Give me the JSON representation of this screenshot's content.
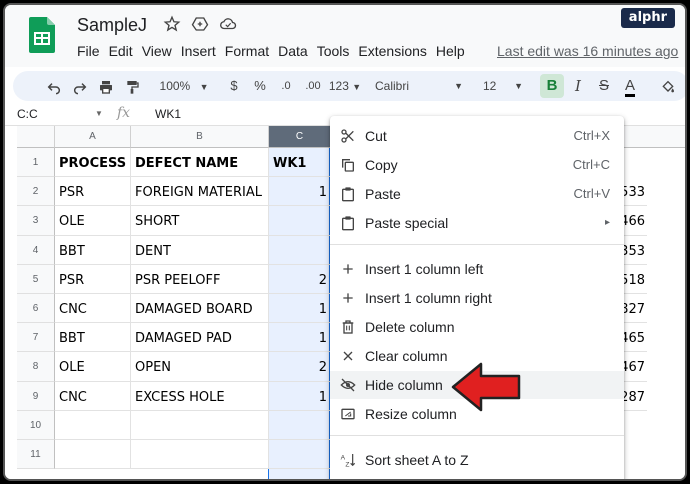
{
  "watermark": "alphr",
  "doc": {
    "title": "SampleJ",
    "last_edit": "Last edit was 16 minutes ago",
    "menu": [
      "File",
      "Edit",
      "View",
      "Insert",
      "Format",
      "Data",
      "Tools",
      "Extensions",
      "Help"
    ]
  },
  "toolbar": {
    "zoom": "100%",
    "currency": "$",
    "percent": "%",
    "dec_decrease": ".0",
    "dec_increase": ".00",
    "more_formats": "123",
    "font": "Calibri",
    "font_size": "12",
    "bold": "B",
    "italic": "I",
    "strike": "S",
    "text_color": "A"
  },
  "formula_bar": {
    "name_box": "C:C",
    "fx": "fx",
    "value": "WK1"
  },
  "columns": [
    "A",
    "B",
    "C"
  ],
  "rows": [
    "1",
    "2",
    "3",
    "4",
    "5",
    "6",
    "7",
    "8",
    "9",
    "10",
    "11"
  ],
  "table": {
    "header": [
      "PROCESS",
      "DEFECT NAME",
      "WK1"
    ],
    "data": [
      [
        "PSR",
        "FOREIGN MATERIAL",
        "1",
        "533"
      ],
      [
        "OLE",
        "SHORT",
        "",
        "466"
      ],
      [
        "BBT",
        "DENT",
        "",
        "353"
      ],
      [
        "PSR",
        "PSR PEELOFF",
        "2",
        "518"
      ],
      [
        "CNC",
        "DAMAGED BOARD",
        "1",
        "827"
      ],
      [
        "BBT",
        "DAMAGED PAD",
        "1",
        "465"
      ],
      [
        "OLE",
        "OPEN",
        "2",
        "467"
      ],
      [
        "CNC",
        "EXCESS HOLE",
        "1",
        "287"
      ]
    ]
  },
  "context_menu": {
    "cut": {
      "label": "Cut",
      "shortcut": "Ctrl+X"
    },
    "copy": {
      "label": "Copy",
      "shortcut": "Ctrl+C"
    },
    "paste": {
      "label": "Paste",
      "shortcut": "Ctrl+V"
    },
    "paste_special": {
      "label": "Paste special",
      "shortcut": "▸"
    },
    "insert_left": {
      "label": "Insert 1 column left"
    },
    "insert_right": {
      "label": "Insert 1 column right"
    },
    "delete_col": {
      "label": "Delete column"
    },
    "clear_col": {
      "label": "Clear column"
    },
    "hide_col": {
      "label": "Hide column"
    },
    "resize_col": {
      "label": "Resize column"
    },
    "sort_az": {
      "label": "Sort sheet A to Z"
    }
  },
  "colors": {
    "accent": "#1a73e8",
    "logo_green": "#0f9d58",
    "arrow_red": "#e02020",
    "bold_active": "#188038"
  }
}
